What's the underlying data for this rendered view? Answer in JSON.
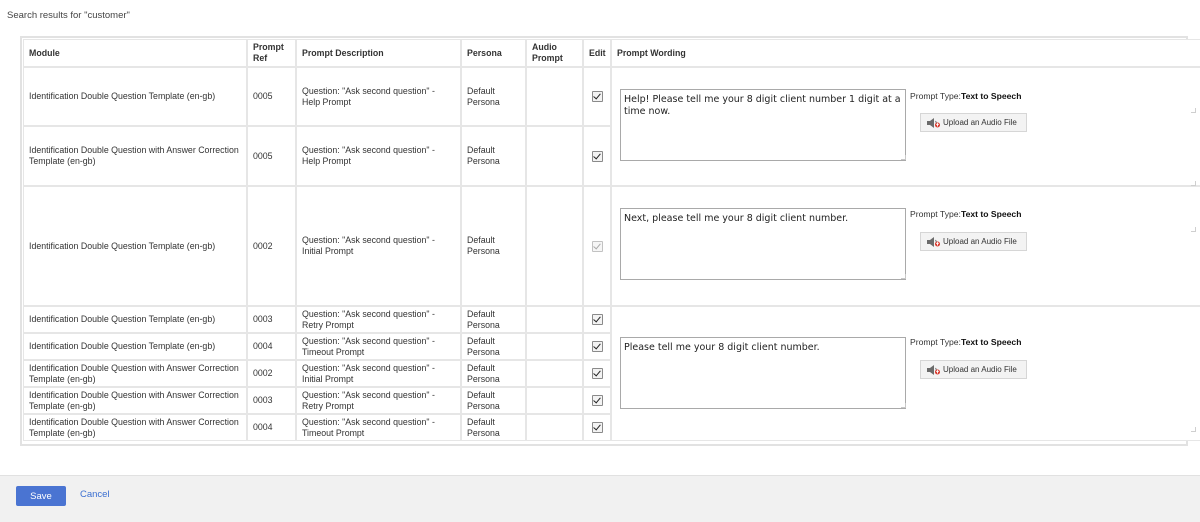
{
  "search_title": "Search results for \"customer\"",
  "columns": {
    "module": "Module",
    "prompt_ref": "Prompt Ref",
    "prompt_description": "Prompt Description",
    "persona": "Persona",
    "audio_prompt": "Audio Prompt",
    "edit": "Edit",
    "prompt_wording": "Prompt Wording"
  },
  "rows": [
    {
      "module": "Identification Double Question Template (en-gb)",
      "ref": "0005",
      "description": "Question: \"Ask second question\" - Help Prompt",
      "persona": "Default Persona",
      "edit_checked": true,
      "edit_disabled": false
    },
    {
      "module": "Identification Double Question with Answer Correction Template (en-gb)",
      "ref": "0005",
      "description": "Question: \"Ask second question\" - Help Prompt",
      "persona": "Default Persona",
      "edit_checked": true,
      "edit_disabled": false
    },
    {
      "module": "Identification Double Question Template (en-gb)",
      "ref": "0002",
      "description": "Question: \"Ask second question\" - Initial Prompt",
      "persona": "Default Persona",
      "edit_checked": true,
      "edit_disabled": true
    },
    {
      "module": "Identification Double Question Template (en-gb)",
      "ref": "0003",
      "description": "Question: \"Ask second question\" - Retry Prompt",
      "persona": "Default Persona",
      "edit_checked": true,
      "edit_disabled": false
    },
    {
      "module": "Identification Double Question Template (en-gb)",
      "ref": "0004",
      "description": "Question: \"Ask second question\" - Timeout Prompt",
      "persona": "Default Persona",
      "edit_checked": true,
      "edit_disabled": false
    },
    {
      "module": "Identification Double Question with Answer Correction Template (en-gb)",
      "ref": "0002",
      "description": "Question: \"Ask second question\" - Initial Prompt",
      "persona": "Default Persona",
      "edit_checked": true,
      "edit_disabled": false
    },
    {
      "module": "Identification Double Question with Answer Correction Template (en-gb)",
      "ref": "0003",
      "description": "Question: \"Ask second question\" - Retry Prompt",
      "persona": "Default Persona",
      "edit_checked": true,
      "edit_disabled": false
    },
    {
      "module": "Identification Double Question with Answer Correction Template (en-gb)",
      "ref": "0004",
      "description": "Question: \"Ask second question\" - Timeout Prompt",
      "persona": "Default Persona",
      "edit_checked": true,
      "edit_disabled": false
    }
  ],
  "wording_groups": [
    {
      "text": "Help! Please tell me your 8 digit client number 1 digit at a time now.",
      "type_label": "Prompt Type:",
      "type_value": "Text to Speech",
      "upload_label": "Upload an Audio File",
      "upload_icon": "speaker-upload-icon"
    },
    {
      "text": "Next, please tell me your 8 digit client number.",
      "type_label": "Prompt Type:",
      "type_value": "Text to Speech",
      "upload_label": "Upload an Audio File",
      "upload_icon": "speaker-upload-icon"
    },
    {
      "text": "Please tell me your 8 digit client number.",
      "type_label": "Prompt Type:",
      "type_value": "Text to Speech",
      "upload_label": "Upload an Audio File",
      "upload_icon": "speaker-upload-icon"
    }
  ],
  "footer": {
    "save_label": "Save",
    "cancel_label": "Cancel"
  },
  "colors": {
    "primary": "#4a74d2",
    "link": "#3b6fd1",
    "border": "#e6e6e6",
    "footer_bg": "#f1f1f1"
  }
}
